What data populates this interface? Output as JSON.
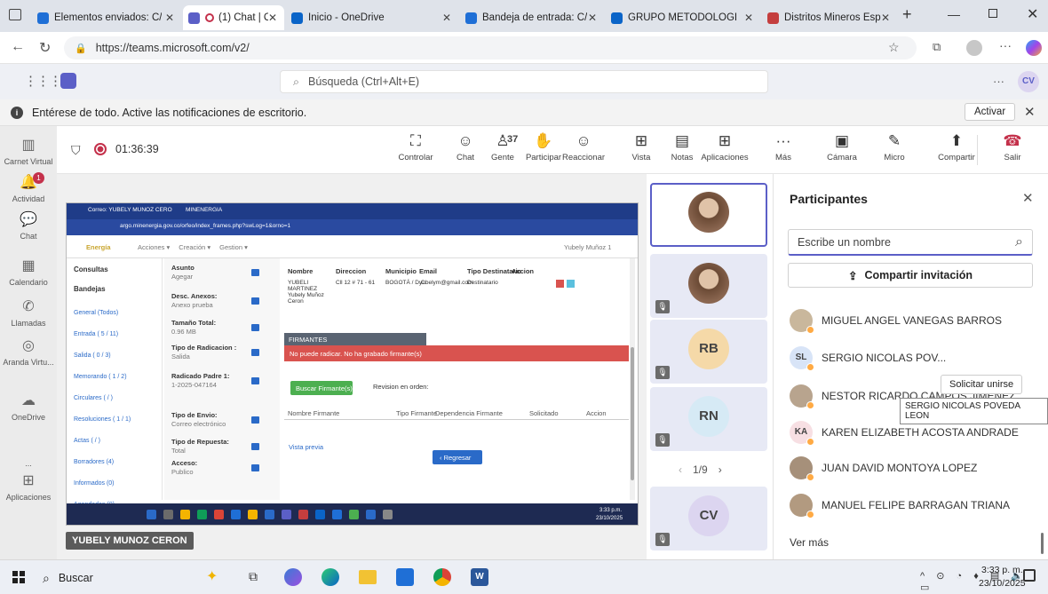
{
  "browser": {
    "tabs": [
      {
        "title": "Elementos enviados: C/",
        "color": "#1f6fd6"
      },
      {
        "title": "(1) Chat | Capacita",
        "color": "#5b5fc7"
      },
      {
        "title": "Inicio - OneDrive",
        "color": "#0a64c8"
      },
      {
        "title": "Bandeja de entrada: C/",
        "color": "#1f6fd6"
      },
      {
        "title": "GRUPO METODOLÓGI",
        "color": "#0a64c8"
      },
      {
        "title": "Distritos Mineros Espe",
        "color": "#c43e3e"
      }
    ],
    "url": "https://teams.microsoft.com/v2/"
  },
  "teams": {
    "search_placeholder": "Búsqueda (Ctrl+Alt+E)",
    "user_initials": "CV",
    "notification_text": "Entérese de todo. Active las notificaciones de escritorio.",
    "activate_label": "Activar"
  },
  "rail": [
    {
      "label": "Carnet Virtual",
      "icon": "▥"
    },
    {
      "label": "Actividad",
      "icon": "🔔"
    },
    {
      "label": "Chat",
      "icon": "💬"
    },
    {
      "label": "Calendario",
      "icon": "▦"
    },
    {
      "label": "Llamadas",
      "icon": "✆"
    },
    {
      "label": "Aranda Virtu...",
      "icon": "◎"
    },
    {
      "label": "OneDrive",
      "icon": "☁"
    },
    {
      "label": "...",
      "icon": ""
    },
    {
      "label": "Aplicaciones",
      "icon": "⊞"
    }
  ],
  "meeting": {
    "timer": "01:36:39",
    "people_count": "37",
    "buttons": [
      "Controlar",
      "Chat",
      "Gente",
      "Participar",
      "Reaccionar",
      "Vista",
      "Notas",
      "Aplicaciones",
      "Más",
      "Cámara",
      "Micro",
      "Compartir",
      "Salir"
    ],
    "sharer_name": "YUBELY MUNOZ CERON"
  },
  "shared_screen": {
    "tab1": "Correo: YUBELY MUNOZ CERO",
    "tab2": "MINENERGIA",
    "url": "argo.minenergia.gov.co/orfeo/index_frames.php?swLog=1&orno=1",
    "menu": [
      "Acciones ▾",
      "Creación ▾",
      "Gestion ▾"
    ],
    "user": "Yubely Muñoz 1",
    "sidebar_heads": [
      "Consultas",
      "Bandejas"
    ],
    "sidebar_links": [
      "General (Todos)",
      "Entrada ( 5 / 11)",
      "Salida ( 0 / 3)",
      "Memorando ( 1 / 2)",
      "Circulares ( / )",
      "Resoluciones ( 1 / 1)",
      "Actas ( / )",
      "Borradores (4)",
      "Informados (0)",
      "Agendados (0)"
    ],
    "fields": [
      {
        "label": "Asunto",
        "value": "Agegar"
      },
      {
        "label": "Desc. Anexos:",
        "value": "Anexo prueba"
      },
      {
        "label": "Tamaño Total:",
        "value": "0.96 MB"
      },
      {
        "label": "Tipo de Radicacion :",
        "value": "Salida"
      },
      {
        "label": "Radicado Padre 1:",
        "value": "1-2025-047164"
      },
      {
        "label": "Tipo de Envio:",
        "value": "Correo electrónico"
      },
      {
        "label": "Tipo de Repuesta:",
        "value": "Total"
      },
      {
        "label": "Acceso:",
        "value": "Publico"
      }
    ],
    "table_headers": [
      "Nombre",
      "Direccion",
      "Municipio",
      "Email",
      "Tipo Destinatario",
      "Accion"
    ],
    "table_row": [
      "YUBELI MARTINEZ Yubely Muñoz Ceron",
      "Cll 12 # 71 - 61",
      "BOGOTÁ / D.C.",
      "yubelym@gmail.com",
      "Destinatario"
    ],
    "firmantes_title": "FIRMANTES",
    "firmantes_error": "No puede radicar. No ha grabado firmante(s)",
    "buscar_btn": "Buscar Firmante(s)",
    "revision": "Revision en orden:",
    "firm_headers": [
      "Nombre Firmante",
      "Tipo Firmante",
      "Dependencia Firmante",
      "Solicitado",
      "Accion"
    ],
    "vista_previa": "Vista previa",
    "regresar": "‹ Regresar",
    "clock": "3:33 p.m.",
    "date": "23/10/2025"
  },
  "strip": {
    "tiles": [
      {
        "initials": "",
        "color": "#f0e6dc",
        "photo": true
      },
      {
        "initials": "",
        "color": "#e8e2da",
        "photo": true
      },
      {
        "initials": "RB",
        "color": "#f5d9a8"
      },
      {
        "initials": "RN",
        "color": "#d6eaf5"
      },
      {
        "initials": "CV",
        "color": "#dcd5f0"
      }
    ],
    "pager": "1/9"
  },
  "participants": {
    "title": "Participantes",
    "search_placeholder": "Escribe un nombre",
    "invite_label": "Compartir invitación",
    "people": [
      {
        "name": "MIGUEL ANGEL VANEGAS BARROS",
        "initials": "",
        "color": "#c9b79c"
      },
      {
        "name": "SERGIO NICOLAS POV...",
        "initials": "SL",
        "color": "#d8e4f7"
      },
      {
        "name": "NESTOR RICARDO CAMPOS JIMENEZ",
        "initials": "",
        "color": "#b8a48e"
      },
      {
        "name": "KAREN ELIZABETH ACOSTA ANDRADE",
        "initials": "KA",
        "color": "#f7dfe3"
      },
      {
        "name": "JUAN DAVID MONTOYA LOPEZ",
        "initials": "",
        "color": "#a6907a"
      },
      {
        "name": "MANUEL FELIPE BARRAGAN TRIANA",
        "initials": "",
        "color": "#b29a80"
      }
    ],
    "request_label": "Solicitar unirse",
    "tooltip": "SERGIO NICOLAS POVEDA LEON",
    "more_label": "Ver más"
  },
  "taskbar": {
    "search_label": "Buscar",
    "time": "3:33 p. m.",
    "date": "23/10/2025"
  }
}
